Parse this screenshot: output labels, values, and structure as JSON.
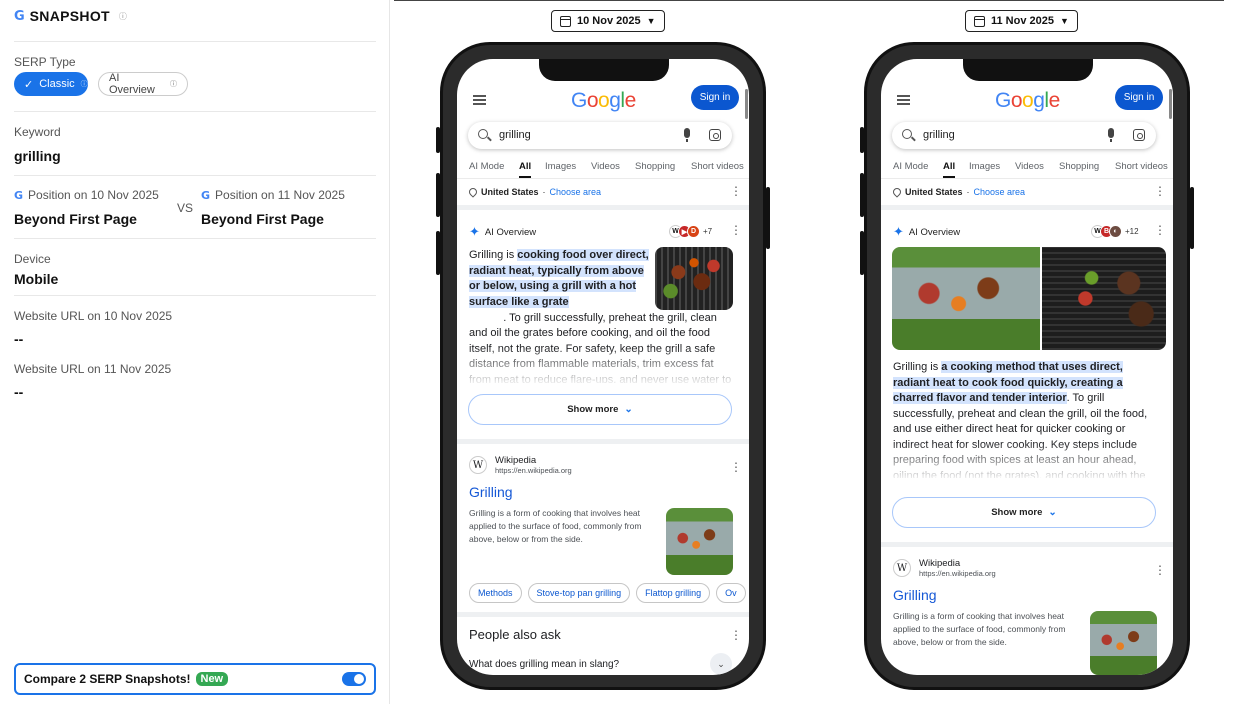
{
  "app": {
    "brand": "SNAPSHOT",
    "g_mark": "G"
  },
  "sidebar": {
    "serp_type_label": "SERP Type",
    "pill_classic": "Classic",
    "pill_ai": "AI Overview",
    "keyword_label": "Keyword",
    "keyword_value": "grilling",
    "pos1_label": "Position on 10 Nov 2025",
    "pos1_value": "Beyond First Page",
    "vs": "VS",
    "pos2_label": "Position on 11 Nov 2025",
    "pos2_value": "Beyond First Page",
    "device_label": "Device",
    "device_value": "Mobile",
    "url1_label": "Website URL on 10 Nov 2025",
    "url1_value": "--",
    "url2_label": "Website URL on 11 Nov 2025",
    "url2_value": "--",
    "compare_label": "Compare 2 SERP Snapshots!",
    "compare_badge": "New",
    "compare_enabled": true
  },
  "colors": {
    "accent": "#1a73e8",
    "new_badge": "#34a853",
    "google_blue": "#0b57d0"
  },
  "snapshots": [
    {
      "date": "10 Nov 2025",
      "google": {
        "logo": "Google",
        "sign_in": "Sign in",
        "query": "grilling"
      },
      "tabs": [
        "AI Mode",
        "All",
        "Images",
        "Videos",
        "Shopping",
        "Short videos"
      ],
      "location": {
        "country": "United States",
        "separator": " · ",
        "link": "Choose area"
      },
      "ai_overview": {
        "label": "AI Overview",
        "source_count": "+7",
        "text_intro": "Grilling is ",
        "text_highlight": "cooking food over direct, radiant heat, typically from above or below, using a grill with a hot surface like a grate",
        "text_rest": ". To grill successfully, preheat the grill, clean and oil the grates before cooking, and oil the food itself, not the grate. For safety, keep the grill a safe distance from flammable materials, trim excess fat from meat to reduce flare-ups, and never use water to put out a fire.",
        "show_more": "Show more"
      },
      "result": {
        "site": "Wikipedia",
        "url": "https://en.wikipedia.org",
        "title": "Grilling",
        "snippet": "Grilling is a form of cooking that involves heat applied to the surface of food, commonly from above, below or from the side."
      },
      "chips": [
        "Methods",
        "Stove-top pan grilling",
        "Flattop grilling",
        "Ov"
      ],
      "paa": {
        "title": "People also ask",
        "question": "What does grilling mean in slang?"
      }
    },
    {
      "date": "11 Nov 2025",
      "google": {
        "logo": "Google",
        "sign_in": "Sign in",
        "query": "grilling"
      },
      "tabs": [
        "AI Mode",
        "All",
        "Images",
        "Videos",
        "Shopping",
        "Short videos"
      ],
      "location": {
        "country": "United States",
        "separator": " · ",
        "link": "Choose area"
      },
      "ai_overview": {
        "label": "AI Overview",
        "source_count": "+12",
        "text_intro": "Grilling is ",
        "text_highlight": "a cooking method that uses direct, radiant heat to cook food quickly, creating a charred flavor and tender interior",
        "text_rest": ". To grill successfully, preheat and clean the grill, oil the food, and use either direct heat for quicker cooking or indirect heat for slower cooking. Key steps include preparing food with spices at least an hour ahead, oiling the food (not the grates), and cooking with the grill lid on or off as needed.",
        "show_more": "Show more"
      },
      "result": {
        "site": "Wikipedia",
        "url": "https://en.wikipedia.org",
        "title": "Grilling",
        "snippet": "Grilling is a form of cooking that involves heat applied to the surface of food, commonly from above, below or from the side."
      }
    }
  ]
}
